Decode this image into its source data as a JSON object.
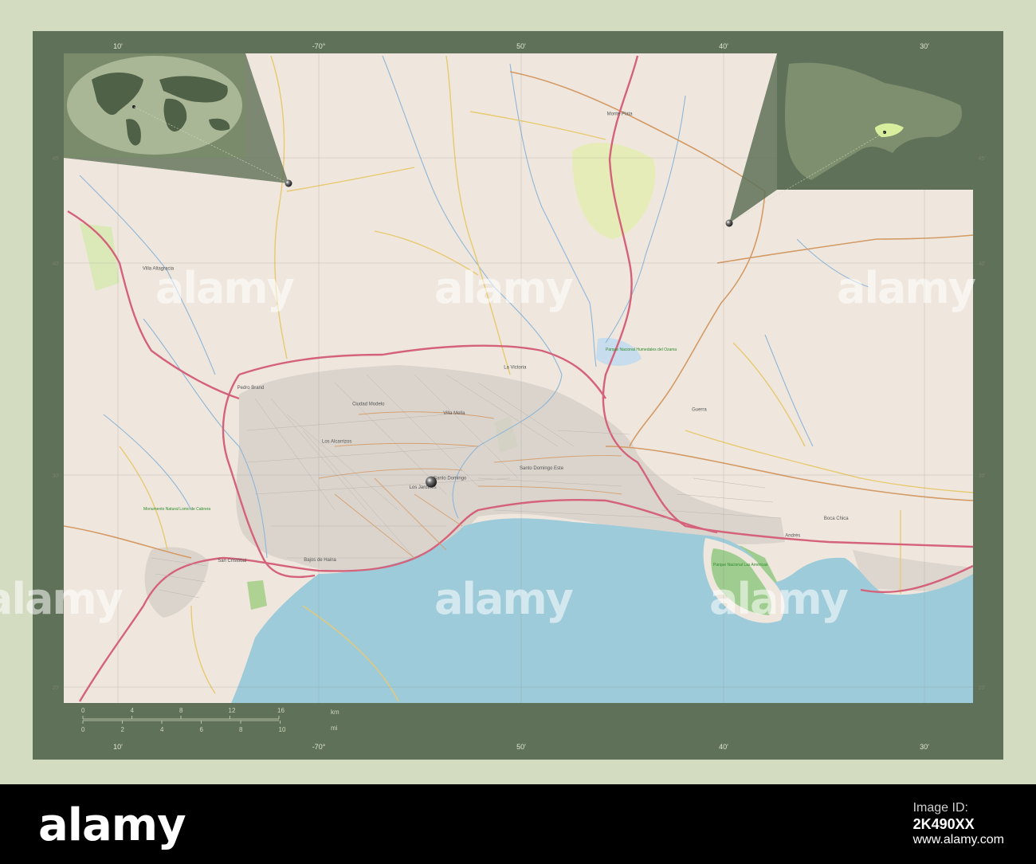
{
  "map": {
    "places": [
      {
        "name": "Monte Plata",
        "lon": -69.785,
        "lat": 18.806
      },
      {
        "name": "Villa Mella",
        "lon": -69.92,
        "lat": 18.545
      },
      {
        "name": "Ciudad Modelo",
        "lon": -69.995,
        "lat": 18.553
      },
      {
        "name": "Los Alcarrizos",
        "lon": -70.02,
        "lat": 18.52
      },
      {
        "name": "Santo Domingo",
        "lon": -69.928,
        "lat": 18.488
      },
      {
        "name": "Santo Domingo Este",
        "lon": -69.857,
        "lat": 18.497
      },
      {
        "name": "Pedro Brand",
        "lon": -70.09,
        "lat": 18.567
      },
      {
        "name": "Villa Altagracia",
        "lon": -70.168,
        "lat": 18.671
      },
      {
        "name": "San Cristóbal",
        "lon": -70.106,
        "lat": 18.416
      },
      {
        "name": "Bajos de Haina",
        "lon": -70.035,
        "lat": 18.417
      },
      {
        "name": "Andrés",
        "lon": -69.638,
        "lat": 18.438
      },
      {
        "name": "Boca Chica",
        "lon": -69.606,
        "lat": 18.453
      },
      {
        "name": "La Victoria",
        "lon": -69.87,
        "lat": 18.585
      },
      {
        "name": "Los Jardines",
        "lon": -69.948,
        "lat": 18.48
      },
      {
        "name": "Guerra",
        "lon": -69.715,
        "lat": 18.548
      }
    ],
    "parks": [
      "Parque Nacional Humedales del Ozama",
      "Parque Nacional Las Américas",
      "Monumento Natural Lomo de Cabrera"
    ],
    "center_marker": {
      "lon": -69.93,
      "lat": 18.486
    },
    "overview_marker": {
      "lon": -70.0,
      "lat": 18.75
    },
    "inset_world_marker": "Dominican Republic",
    "scale": {
      "km_ticks": [
        "0",
        "4",
        "8",
        "12",
        "16"
      ],
      "km_unit": "km",
      "mi_ticks": [
        "0",
        "2",
        "4",
        "6",
        "8",
        "10"
      ],
      "mi_unit": "mi"
    },
    "graticule": {
      "lon_ticks_top": [
        "10'",
        "-70°",
        "50'",
        "40'",
        "30'"
      ],
      "lon_ticks_bottom": [
        "10'",
        "-70°",
        "50'",
        "40'",
        "30'"
      ],
      "lat_ticks": [
        "45'",
        "40'",
        "30'",
        "20'"
      ]
    },
    "colors": {
      "frame": "#5f7158",
      "outer": "#d3dcc0",
      "land": "#efe7dd",
      "sea": "#9ecbd9",
      "urban": "#d8d2cb",
      "motorway": "#d4627a",
      "primary": "#d49a66",
      "secondary": "#e7c971",
      "river": "#8eb6d8",
      "park": "#cfe4a8",
      "inset_land": "#7d8f6e",
      "inset_sea": "#a9b797",
      "inset_highlight": "#d8ee9c"
    }
  },
  "footer": {
    "brand": "alamy",
    "image_id_label": "Image ID:",
    "image_id": "2K490XX",
    "site": "www.alamy.com"
  },
  "watermark": "alamy"
}
